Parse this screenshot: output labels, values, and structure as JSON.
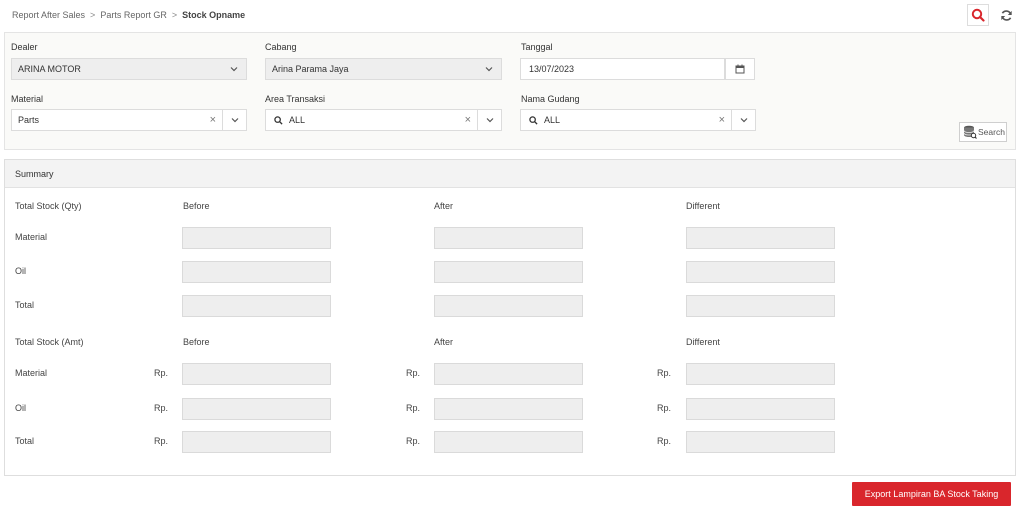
{
  "breadcrumb": {
    "items": [
      "Report After Sales",
      "Parts Report GR"
    ],
    "current": "Stock Opname",
    "separator": ">"
  },
  "filters": {
    "dealer": {
      "label": "Dealer",
      "value": "ARINA MOTOR"
    },
    "cabang": {
      "label": "Cabang",
      "value": "Arina Parama Jaya"
    },
    "tanggal": {
      "label": "Tanggal",
      "value": "13/07/2023"
    },
    "material": {
      "label": "Material",
      "value": "Parts"
    },
    "area_transaksi": {
      "label": "Area Transaksi",
      "value": "ALL"
    },
    "nama_gudang": {
      "label": "Nama Gudang",
      "value": "ALL"
    },
    "search_label": "Search"
  },
  "summary": {
    "title": "Summary",
    "qty": {
      "heading": "Total Stock (Qty)",
      "columns": [
        "Before",
        "After",
        "Different"
      ],
      "rows": [
        "Material",
        "Oil",
        "Total"
      ]
    },
    "amt": {
      "heading": "Total Stock (Amt)",
      "columns": [
        "Before",
        "After",
        "Different"
      ],
      "rows": [
        "Material",
        "Oil",
        "Total"
      ],
      "currency": "Rp."
    }
  },
  "export_label": "Export Lampiran BA Stock Taking",
  "colors": {
    "accent": "#d9262c",
    "icon_red": "#d9262c"
  }
}
